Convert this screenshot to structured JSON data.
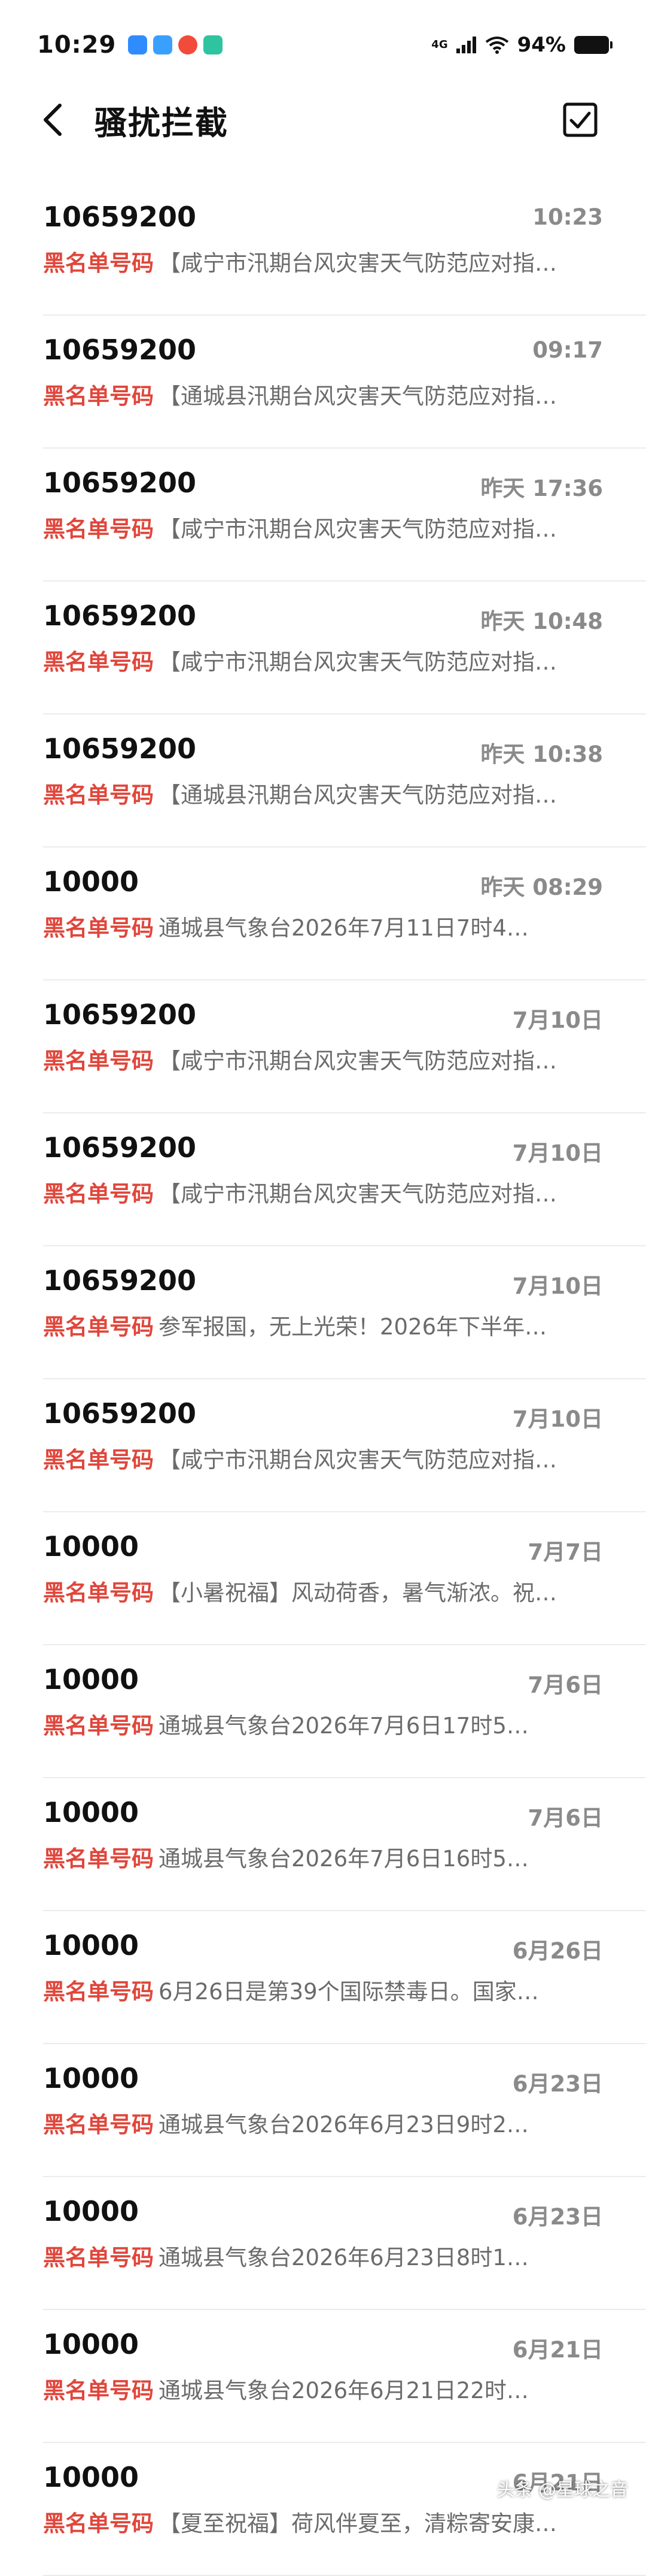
{
  "status_bar": {
    "time": "10:29",
    "network": "4G",
    "battery": "94%",
    "notification_icons": [
      {
        "name": "app-icon-blue",
        "color": "#2f8cff"
      },
      {
        "name": "app-icon-grid",
        "color": "#3aa0ff"
      },
      {
        "name": "weibo-icon",
        "color": "#f24b3b"
      },
      {
        "name": "app-icon-green",
        "color": "#2ec4a0"
      }
    ]
  },
  "header": {
    "title": "骚扰拦截"
  },
  "colors": {
    "tag": "#e0463b",
    "preview": "#6b6b6b",
    "time": "#8a8a8a"
  },
  "messages": [
    {
      "sender": "10659200",
      "time": "10:23",
      "tag": "黑名单号码",
      "preview": "【咸宁市汛期台风灾害天气防范应对指…"
    },
    {
      "sender": "10659200",
      "time": "09:17",
      "tag": "黑名单号码",
      "preview": "【通城县汛期台风灾害天气防范应对指…"
    },
    {
      "sender": "10659200",
      "time": "昨天 17:36",
      "tag": "黑名单号码",
      "preview": "【咸宁市汛期台风灾害天气防范应对指…"
    },
    {
      "sender": "10659200",
      "time": "昨天 10:48",
      "tag": "黑名单号码",
      "preview": "【咸宁市汛期台风灾害天气防范应对指…"
    },
    {
      "sender": "10659200",
      "time": "昨天 10:38",
      "tag": "黑名单号码",
      "preview": "【通城县汛期台风灾害天气防范应对指…"
    },
    {
      "sender": "10000",
      "time": "昨天 08:29",
      "tag": "黑名单号码",
      "preview": "通城县气象台2026年7月11日7时4…"
    },
    {
      "sender": "10659200",
      "time": "7月10日",
      "tag": "黑名单号码",
      "preview": "【咸宁市汛期台风灾害天气防范应对指…"
    },
    {
      "sender": "10659200",
      "time": "7月10日",
      "tag": "黑名单号码",
      "preview": "【咸宁市汛期台风灾害天气防范应对指…"
    },
    {
      "sender": "10659200",
      "time": "7月10日",
      "tag": "黑名单号码",
      "preview": "参军报国，无上光荣！2026年下半年…"
    },
    {
      "sender": "10659200",
      "time": "7月10日",
      "tag": "黑名单号码",
      "preview": "【咸宁市汛期台风灾害天气防范应对指…"
    },
    {
      "sender": "10000",
      "time": "7月7日",
      "tag": "黑名单号码",
      "preview": "【小暑祝福】风动荷香，暑气渐浓。祝…"
    },
    {
      "sender": "10000",
      "time": "7月6日",
      "tag": "黑名单号码",
      "preview": "通城县气象台2026年7月6日17时5…"
    },
    {
      "sender": "10000",
      "time": "7月6日",
      "tag": "黑名单号码",
      "preview": "通城县气象台2026年7月6日16时5…"
    },
    {
      "sender": "10000",
      "time": "6月26日",
      "tag": "黑名单号码",
      "preview": "6月26日是第39个国际禁毒日。国家…"
    },
    {
      "sender": "10000",
      "time": "6月23日",
      "tag": "黑名单号码",
      "preview": "通城县气象台2026年6月23日9时2…"
    },
    {
      "sender": "10000",
      "time": "6月23日",
      "tag": "黑名单号码",
      "preview": "通城县气象台2026年6月23日8时1…"
    },
    {
      "sender": "10000",
      "time": "6月21日",
      "tag": "黑名单号码",
      "preview": "通城县气象台2026年6月21日22时…"
    },
    {
      "sender": "10000",
      "time": "6月21日",
      "tag": "黑名单号码",
      "preview": "【夏至祝福】荷风伴夏至，清粽寄安康…"
    }
  ],
  "watermark": "头条 @星球之音"
}
